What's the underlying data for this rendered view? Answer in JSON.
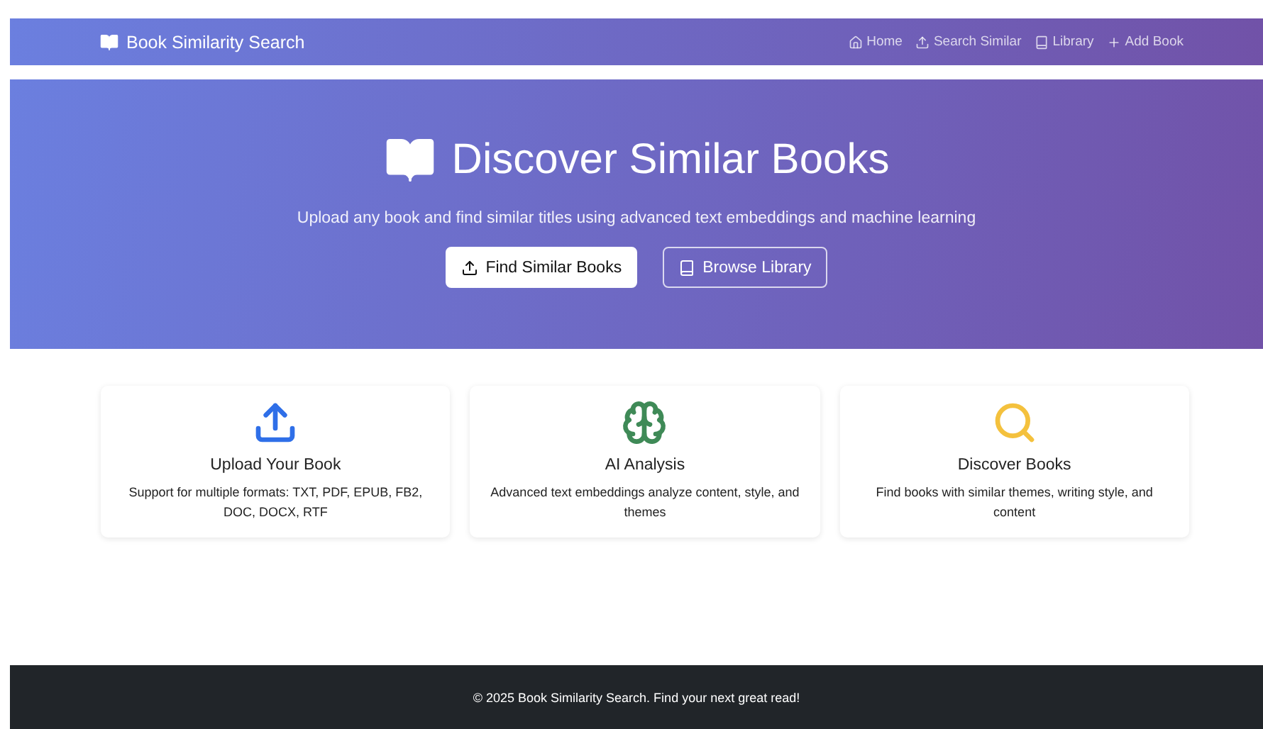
{
  "navbar": {
    "brand": "Book Similarity Search",
    "links": [
      {
        "label": "Home"
      },
      {
        "label": "Search Similar"
      },
      {
        "label": "Library"
      },
      {
        "label": "Add Book"
      }
    ]
  },
  "hero": {
    "title": "Discover Similar Books",
    "subtitle": "Upload any book and find similar titles using advanced text embeddings and machine learning",
    "buttons": [
      {
        "label": "Find Similar Books",
        "kind": "solid"
      },
      {
        "label": "Browse Library",
        "kind": "outline"
      }
    ]
  },
  "features": [
    {
      "title": "Upload Your Book",
      "text": "Support for multiple formats: TXT, PDF, EPUB, FB2, DOC, DOCX, RTF",
      "color": "#2f6fe8"
    },
    {
      "title": "AI Analysis",
      "text": "Advanced text embeddings analyze content, style, and themes",
      "color": "#3f8a57"
    },
    {
      "title": "Discover Books",
      "text": "Find books with similar themes, writing style, and content",
      "color": "#f4c13d"
    }
  ],
  "footer": "© 2025 Book Similarity Search. Find your next great read!"
}
